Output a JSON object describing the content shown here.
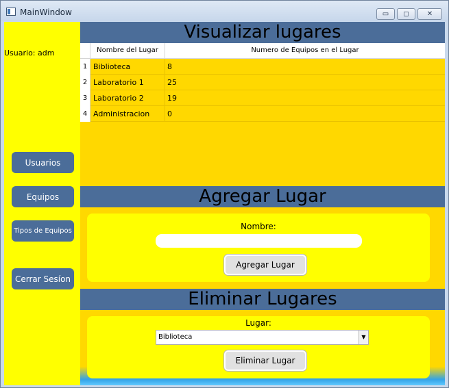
{
  "window": {
    "title": "MainWindow",
    "controls": {
      "minimize": "▭",
      "maximize": "◻",
      "close": "✕"
    }
  },
  "sidebar": {
    "user_label": "Usuario: adm",
    "buttons": [
      {
        "label": "Usuarios"
      },
      {
        "label": "Equipos"
      },
      {
        "label": "Tipos de Equipos"
      },
      {
        "label": "Cerrar Sesíon"
      }
    ]
  },
  "view_section": {
    "title": "Visualizar lugares",
    "columns": [
      "Nombre del Lugar",
      "Numero de Equipos en el Lugar"
    ],
    "rows": [
      {
        "num": "1",
        "name": "Biblioteca",
        "count": "8"
      },
      {
        "num": "2",
        "name": "Laboratorio 1",
        "count": "25"
      },
      {
        "num": "3",
        "name": "Laboratorio 2",
        "count": "19"
      },
      {
        "num": "4",
        "name": "Administracion",
        "count": "0"
      }
    ]
  },
  "add_section": {
    "title": "Agregar Lugar",
    "name_label": "Nombre:",
    "name_value": "",
    "button_label": "Agregar Lugar"
  },
  "delete_section": {
    "title": "Eliminar Lugares",
    "place_label": "Lugar:",
    "selected_place": "Biblioteca",
    "button_label": "Eliminar Lugar"
  },
  "colors": {
    "sidebar_bg": "#ffff00",
    "content_bg": "#ffd800",
    "header_blue": "#4b6d99"
  }
}
